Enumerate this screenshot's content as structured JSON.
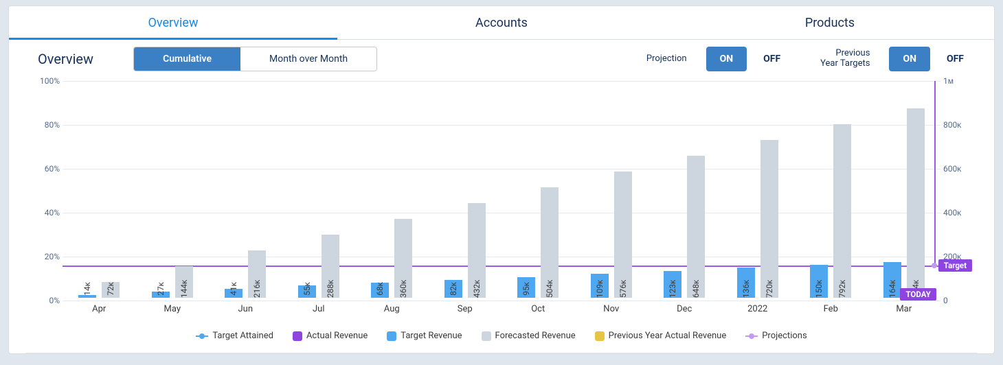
{
  "primary_tabs": {
    "overview": "Overview",
    "accounts": "Accounts",
    "products": "Products",
    "active": "Overview"
  },
  "section_title": "Overview",
  "view_mode": {
    "cumulative": "Cumulative",
    "mom": "Month over Month",
    "active": "Cumulative"
  },
  "toggles": {
    "projection": {
      "label": "Projection",
      "on": "ON",
      "off": "OFF",
      "value": "ON"
    },
    "prev_targets": {
      "label_line1": "Previous",
      "label_line2": "Year Targets",
      "on": "ON",
      "off": "OFF",
      "value": "ON"
    }
  },
  "legend": {
    "target_attained": "Target Attained",
    "actual_revenue": "Actual Revenue",
    "target_revenue": "Target Revenue",
    "forecasted_revenue": "Forecasted Revenue",
    "prev_actual_revenue": "Previous Year Actual Revenue",
    "projections": "Projections"
  },
  "annotations": {
    "today": "TODAY",
    "target": "Target"
  },
  "colors": {
    "blue_bar": "#4fa8ef",
    "grey_bar": "#cdd5df",
    "purple_line": "#9b59e6",
    "actual_purple": "#8e44e0",
    "prev_gold": "#e6c544",
    "tab_active": "#1589ee"
  },
  "chart_data": {
    "type": "bar",
    "categories": [
      "Apr",
      "May",
      "Jun",
      "Jul",
      "Aug",
      "Sep",
      "Oct",
      "Nov",
      "Dec",
      "2022",
      "Feb",
      "Mar"
    ],
    "series": [
      {
        "name": "Target Revenue",
        "color": "#4fa8ef",
        "values": [
          14,
          27,
          41,
          55,
          68,
          82,
          95,
          109,
          123,
          136,
          150,
          164
        ],
        "unit": "K"
      },
      {
        "name": "Forecasted Revenue",
        "color": "#cdd5df",
        "values": [
          72,
          144,
          216,
          288,
          360,
          432,
          504,
          576,
          648,
          720,
          792,
          864
        ],
        "unit": "K"
      }
    ],
    "bar_labels": [
      [
        "14ᴋ",
        "72ᴋ"
      ],
      [
        "27ᴋ",
        "144ᴋ"
      ],
      [
        "41ᴋ",
        "216ᴋ"
      ],
      [
        "55ᴋ",
        "288ᴋ"
      ],
      [
        "68ᴋ",
        "360ᴋ"
      ],
      [
        "82ᴋ",
        "432ᴋ"
      ],
      [
        "95ᴋ",
        "504ᴋ"
      ],
      [
        "109ᴋ",
        "576ᴋ"
      ],
      [
        "123ᴋ",
        "648ᴋ"
      ],
      [
        "136ᴋ",
        "720ᴋ"
      ],
      [
        "150ᴋ",
        "792ᴋ"
      ],
      [
        "164ᴋ",
        "864ᴋ"
      ]
    ],
    "y_left": {
      "label": "",
      "ticks": [
        "0%",
        "20%",
        "40%",
        "60%",
        "80%",
        "100%"
      ],
      "min": 0,
      "max": 100
    },
    "y_right": {
      "label": "",
      "ticks": [
        "0",
        "200ᴋ",
        "400ᴋ",
        "600ᴋ",
        "800ᴋ",
        "1ᴍ"
      ],
      "min": 0,
      "max": 1000000
    },
    "reference_lines": [
      {
        "name": "Target",
        "orientation": "horizontal",
        "value_right": 160000,
        "value_left_pct": 16
      },
      {
        "name": "Projections",
        "orientation": "vertical",
        "from_y_left_pct": 16,
        "to_y_left_pct": 100,
        "x_category": "Mar"
      }
    ],
    "today_marker": {
      "x_category": "Mar"
    }
  }
}
